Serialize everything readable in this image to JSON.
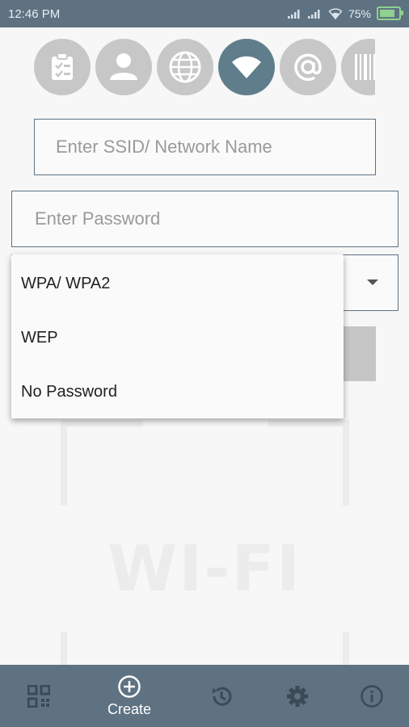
{
  "status_bar": {
    "time": "12:46 PM",
    "battery": "75%"
  },
  "top_icons": [
    "clipboard-icon",
    "contact-icon",
    "globe-icon",
    "wifi-icon",
    "at-sign-icon",
    "barcode-icon"
  ],
  "form": {
    "ssid_placeholder": "Enter SSID/ Network Name",
    "password_placeholder": "Enter Password"
  },
  "dropdown": {
    "options": [
      "WPA/ WPA2",
      "WEP",
      "No Password"
    ]
  },
  "watermark": "WI-FI",
  "bottom_nav": {
    "active": "Create",
    "items": [
      {
        "icon": "qr-code-icon",
        "label": ""
      },
      {
        "icon": "add-circle-icon",
        "label": "Create"
      },
      {
        "icon": "history-icon",
        "label": ""
      },
      {
        "icon": "gear-icon",
        "label": ""
      },
      {
        "icon": "info-icon",
        "label": ""
      }
    ]
  },
  "colors": {
    "primary": "#5e7282",
    "active_circle": "#607d8b",
    "inactive_circle": "#c7c7c7"
  }
}
